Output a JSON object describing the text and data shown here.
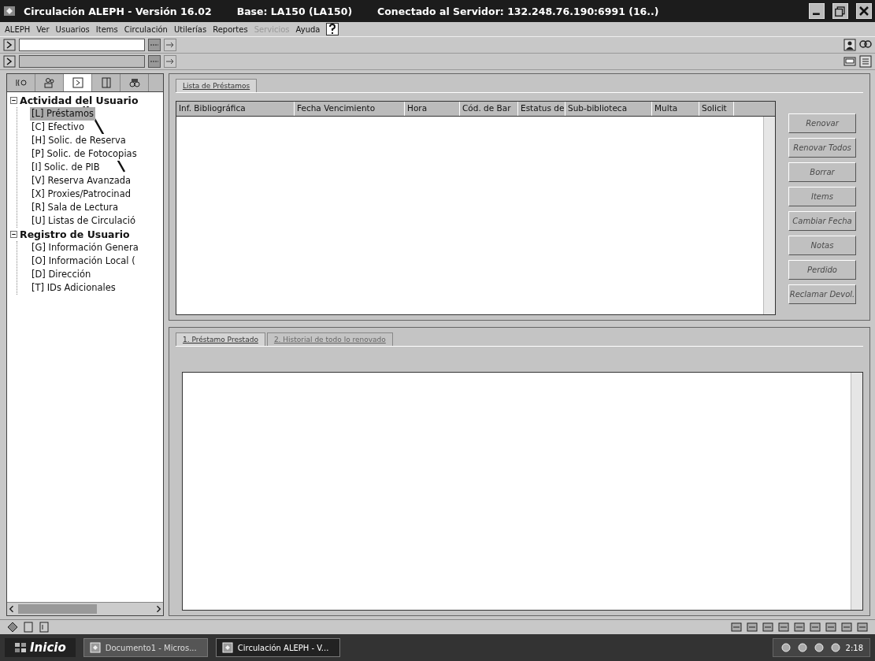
{
  "window": {
    "title": "Circulación ALEPH - Versión 16.02",
    "base": "Base:  LA150 (LA150)",
    "server": "Conectado al Servidor:  132.248.76.190:6991 (16..)"
  },
  "menu": [
    {
      "label": "ALEPH",
      "disabled": false
    },
    {
      "label": "Ver",
      "disabled": false
    },
    {
      "label": "Usuarios",
      "disabled": false
    },
    {
      "label": "Items",
      "disabled": false
    },
    {
      "label": "Circulación",
      "disabled": false
    },
    {
      "label": "Utilerías",
      "disabled": false
    },
    {
      "label": "Reportes",
      "disabled": false
    },
    {
      "label": "Servicios",
      "disabled": true
    },
    {
      "label": "Ayuda",
      "disabled": false
    }
  ],
  "toolbar_rows": [
    {
      "disabled": false
    },
    {
      "disabled": true
    }
  ],
  "side_tabs": [
    {
      "selected": false
    },
    {
      "selected": false
    },
    {
      "selected": true
    },
    {
      "selected": false
    },
    {
      "selected": false
    }
  ],
  "tree": [
    {
      "label": "Actividad del Usuario",
      "expanded": true,
      "children": [
        {
          "label": "[L] Préstamos",
          "selected": true
        },
        {
          "label": "[C] Efectivo",
          "selected": false
        },
        {
          "label": "[H] Solic. de Reserva",
          "selected": false
        },
        {
          "label": "[P] Solic. de Fotocopias",
          "selected": false
        },
        {
          "label": "[I] Solic. de PIB",
          "selected": false
        },
        {
          "label": "[V] Reserva Avanzada",
          "selected": false
        },
        {
          "label": "[X] Proxies/Patrocinad",
          "selected": false
        },
        {
          "label": "[R] Sala de Lectura",
          "selected": false
        },
        {
          "label": "[U] Listas de Circulació",
          "selected": false
        }
      ]
    },
    {
      "label": "Registro de Usuario",
      "expanded": true,
      "children": [
        {
          "label": "[G] Información Genera",
          "selected": false
        },
        {
          "label": "[O] Información Local (",
          "selected": false
        },
        {
          "label": "[D] Dirección",
          "selected": false
        },
        {
          "label": "[T] IDs Adicionales",
          "selected": false
        }
      ]
    }
  ],
  "loans": {
    "tab": "Lista de Préstamos",
    "columns": [
      "Inf. Bibliográfica",
      "Fecha Vencimiento",
      "Hora",
      "Cód. de Bar",
      "Estatus de",
      "Sub-biblioteca",
      "Multa",
      "Solicit"
    ],
    "buttons": [
      {
        "label": "Renovar",
        "disabled": true
      },
      {
        "label": "Renovar Todos",
        "disabled": true
      },
      {
        "label": "Borrar",
        "disabled": true
      },
      {
        "label": "Items",
        "disabled": true
      },
      {
        "label": "Cambiar Fecha",
        "disabled": true
      },
      {
        "label": "Notas",
        "disabled": true
      },
      {
        "label": "Perdido",
        "disabled": true
      },
      {
        "label": "Reclamar Devol.",
        "disabled": true
      }
    ]
  },
  "detail_tabs": [
    {
      "label": "1. Préstamo Prestado",
      "selected": true
    },
    {
      "label": "2. Historial de todo lo renovado",
      "selected": false
    }
  ],
  "taskbar": {
    "start": "Inicio",
    "tasks": [
      {
        "label": "Documento1 - Micros...",
        "selected": false
      },
      {
        "label": "Circulación ALEPH - V...",
        "selected": true
      }
    ],
    "clock": "2:18"
  }
}
